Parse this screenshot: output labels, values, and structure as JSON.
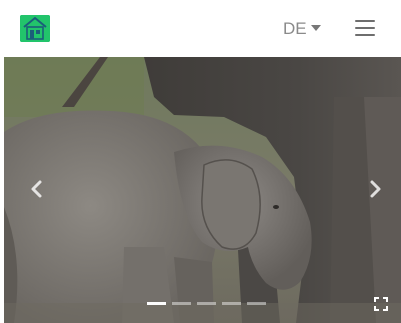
{
  "header": {
    "logo": {
      "icon": "house-logo-icon",
      "color": "#22c46b"
    },
    "language": {
      "label": "DE",
      "icon": "caret-down-icon"
    },
    "menu": {
      "icon": "hamburger-menu-icon"
    }
  },
  "carousel": {
    "image": {
      "subject": "elephant-calf-photo"
    },
    "prev_icon": "chevron-left-icon",
    "next_icon": "chevron-right-icon",
    "slide_count": 5,
    "active_slide": 1,
    "fullscreen_icon": "fullscreen-icon"
  }
}
